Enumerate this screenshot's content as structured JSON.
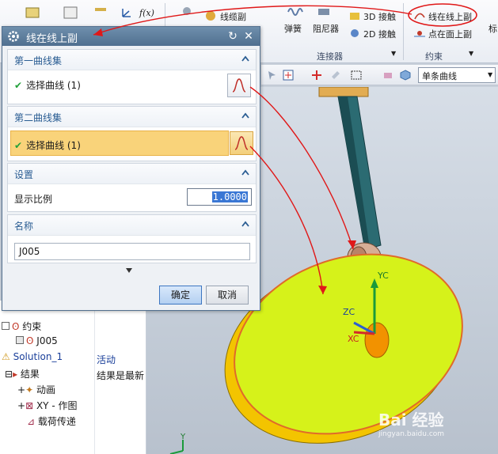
{
  "ribbon": {
    "items": {
      "rope": "线缆副",
      "spring": "弹簧",
      "damper": "阻尼器",
      "contact3d": "3D 接触",
      "contact2d": "2D 接触",
      "curve_on_curve": "线在线上副",
      "point_on_surface": "点在面上副",
      "partial_left": "标"
    },
    "groups": {
      "connectors": "连接器",
      "constraints": "约束"
    }
  },
  "toolbar": {
    "filter_value": "单条曲线"
  },
  "dialog": {
    "title": "线在线上副",
    "sections": {
      "first_curve_set": {
        "title": "第一曲线集",
        "select_label": "选择曲线 (1)"
      },
      "second_curve_set": {
        "title": "第二曲线集",
        "select_label": "选择曲线 (1)"
      },
      "settings": {
        "title": "设置",
        "scale_label": "显示比例",
        "scale_value": "1.0000"
      },
      "name": {
        "title": "名称",
        "value": "J005"
      }
    },
    "ok_label": "确定",
    "cancel_label": "取消"
  },
  "navigator": {
    "rows": [
      {
        "label": "约束",
        "value": ""
      },
      {
        "label": "J005",
        "value": ""
      },
      {
        "label": "Solution_1",
        "value": "活动"
      },
      {
        "label": "结果",
        "value": "结果是最新"
      },
      {
        "label": "动画",
        "value": ""
      },
      {
        "label": "XY - 作图",
        "value": ""
      },
      {
        "label": "载荷传递",
        "value": ""
      }
    ]
  },
  "viewport": {
    "axes": {
      "yc": "YC",
      "zc": "ZC",
      "xc": "XC",
      "y": "Y"
    }
  },
  "watermark": {
    "text": "Bai 经验",
    "sub": "jingyan.baidu.com"
  },
  "colors": {
    "disk_face": "#d8f21e",
    "disk_rim": "#f5c800",
    "arm": "#1f5a60",
    "roller": "#c9a08a",
    "annotation": "#e01818"
  }
}
